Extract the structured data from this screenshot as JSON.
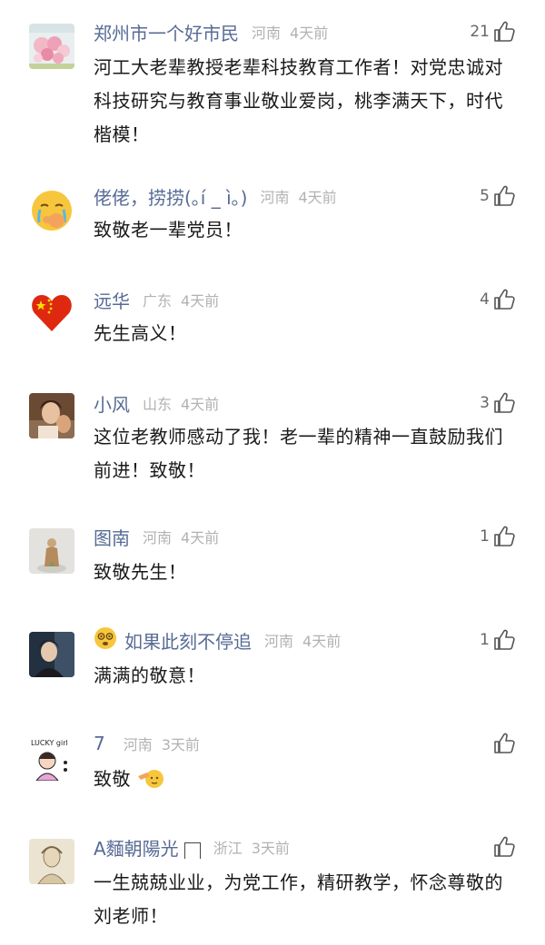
{
  "comments": [
    {
      "name": "郑州市一个好市民",
      "region": "河南",
      "time": "4天前",
      "likes": "21",
      "text": "河工大老辈教授老辈科技教育工作者！对党忠诚对科技研究与教育事业敬业爱岗，桃李满天下，时代楷模！",
      "avatar": "flowers-photo"
    },
    {
      "name": "佬佬，捞捞(｡í _ ì｡)",
      "region": "河南",
      "time": "4天前",
      "likes": "5",
      "text": "致敬老一辈党员！",
      "avatar": "crying-emoji-avatar"
    },
    {
      "name": "远华",
      "region": "广东",
      "time": "4天前",
      "likes": "4",
      "text": "先生高义！",
      "avatar": "china-flag-heart-avatar"
    },
    {
      "name": "小风",
      "region": "山东",
      "time": "4天前",
      "likes": "3",
      "text": "这位老教师感动了我！老一辈的精神一直鼓励我们前进！致敬！",
      "avatar": "portrait-photo"
    },
    {
      "name": "图南",
      "region": "河南",
      "time": "4天前",
      "likes": "1",
      "text": "致敬先生！",
      "avatar": "figure-photo"
    },
    {
      "name": "如果此刻不停追",
      "region": "河南",
      "time": "4天前",
      "likes": "1",
      "text": "满满的敬意！",
      "avatar": "man-portrait-photo",
      "badge": "dizzy-face-emoji"
    },
    {
      "name": "7",
      "region": "河南",
      "time": "3天前",
      "likes": "",
      "text": "致敬",
      "avatar": "lucky-girl-doodle",
      "avatar_text": "LUCKY girl",
      "trailing_emoji": "salute-emoji"
    },
    {
      "name": "A麵朝陽光",
      "region": "浙江",
      "time": "3天前",
      "likes": "",
      "text": "一生兢兢业业，为党工作，精研教学，怀念尊敬的刘老师！",
      "avatar": "vintage-sketch-portrait"
    }
  ],
  "colors": {
    "name": "#576b95",
    "meta": "#b2b2b2",
    "text": "#1a1a1a",
    "like_icon": "#555555"
  }
}
